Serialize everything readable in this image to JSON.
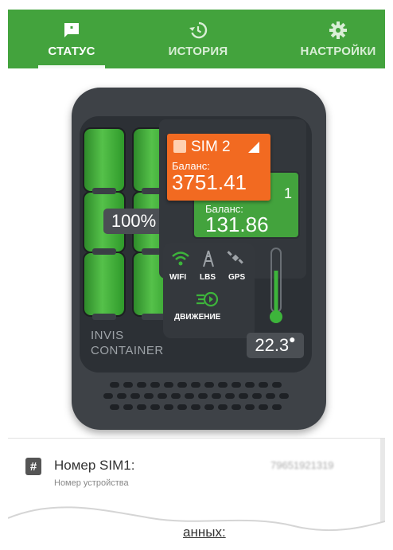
{
  "nav": {
    "tabs": [
      {
        "label": "СТАТУС",
        "icon": "chat-bubble-icon",
        "active": true
      },
      {
        "label": "ИСТОРИЯ",
        "icon": "history-icon",
        "active": false
      },
      {
        "label": "НАСТРОЙКИ",
        "icon": "gear-icon",
        "active": false
      }
    ],
    "accent": "#43a33d"
  },
  "device": {
    "battery_percent_text": "100%",
    "battery_level": 1.0,
    "sim2": {
      "title": "SIM 2",
      "balance_label": "Баланс:",
      "balance": "3751.41",
      "color": "#f26a21"
    },
    "sim1": {
      "number": "1",
      "balance_label": "Баланс:",
      "balance": "131.86",
      "color": "#43a33d"
    },
    "modules": {
      "wifi": "WIFI",
      "lbs": "LBS",
      "gps": "GPS",
      "motion": "ДВИЖЕНИЕ"
    },
    "temperature": "22.3",
    "brand_line1": "INVIS",
    "brand_line2": "CONTAINER"
  },
  "info": {
    "sim_number_label": "Номер SIM1:",
    "sim_number_value": "79651921319",
    "device_number_label": "Номер устройства",
    "data_link": "анных:"
  }
}
